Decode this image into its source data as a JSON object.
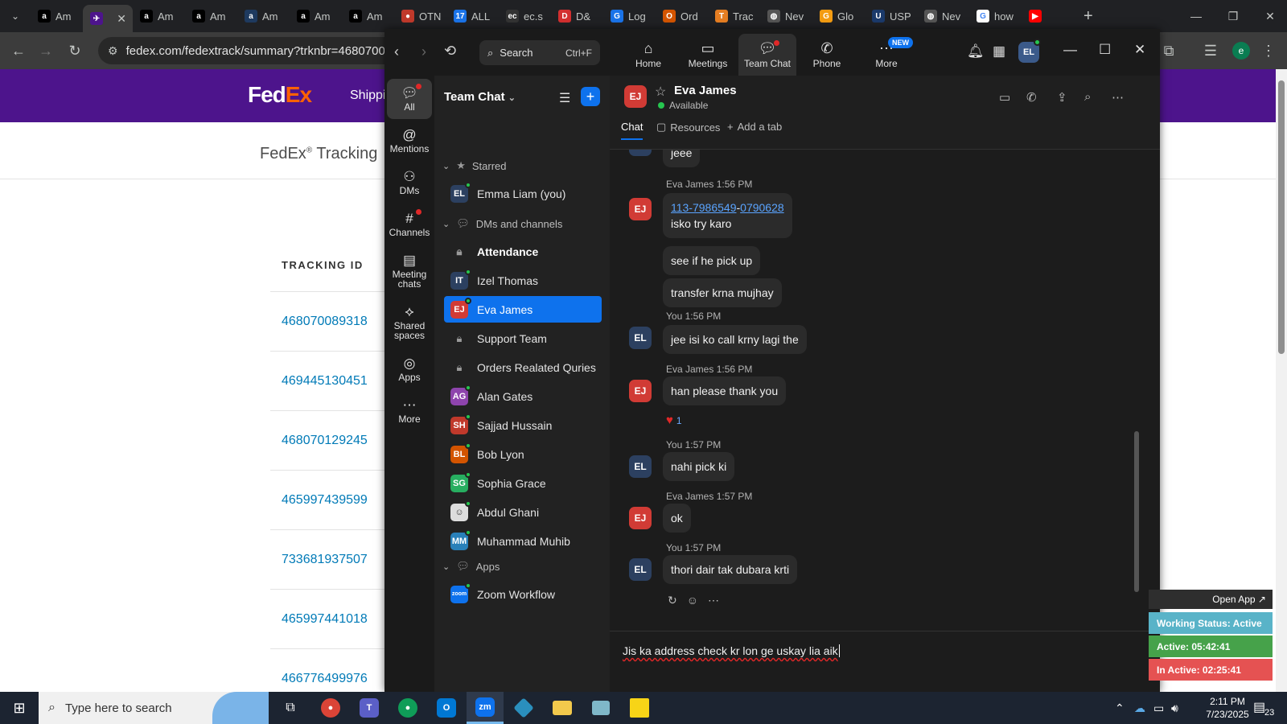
{
  "browser": {
    "tabs": [
      {
        "label": "Am",
        "icon": "amazon-icon",
        "color": "#000000",
        "glyph": "a"
      },
      {
        "label": "",
        "icon": "fedex-icon",
        "color": "#4d148c",
        "glyph": "✈"
      },
      {
        "label": "Am",
        "icon": "amazon-icon",
        "color": "#000000",
        "glyph": "a"
      },
      {
        "label": "Am",
        "icon": "amazon-icon",
        "color": "#000000",
        "glyph": "a"
      },
      {
        "label": "Am",
        "icon": "amazon-icon",
        "color": "#1e3a5f",
        "glyph": "a"
      },
      {
        "label": "Am",
        "icon": "amazon-icon",
        "color": "#000000",
        "glyph": "a"
      },
      {
        "label": "Am",
        "icon": "amazon-icon",
        "color": "#000000",
        "glyph": "a"
      },
      {
        "label": "OTN",
        "icon": "otn-icon",
        "color": "#c0392b",
        "glyph": "●"
      },
      {
        "label": "ALL",
        "icon": "all-icon",
        "color": "#1a73e8",
        "glyph": "17"
      },
      {
        "label": "ec.s",
        "icon": "ec-icon",
        "color": "#333333",
        "glyph": "ec"
      },
      {
        "label": "D&",
        "icon": "dnb-icon",
        "color": "#d32f2f",
        "glyph": "D"
      },
      {
        "label": "Log",
        "icon": "log-icon",
        "color": "#1a73e8",
        "glyph": "G"
      },
      {
        "label": "Ord",
        "icon": "orders-icon",
        "color": "#d35400",
        "glyph": "O"
      },
      {
        "label": "Trac",
        "icon": "track-icon",
        "color": "#e67e22",
        "glyph": "T"
      },
      {
        "label": "Nev",
        "icon": "globe-icon",
        "color": "#555555",
        "glyph": "◍"
      },
      {
        "label": "Glo",
        "icon": "glo-icon",
        "color": "#f39c12",
        "glyph": "G"
      },
      {
        "label": "USP",
        "icon": "usps-icon",
        "color": "#1b3a6b",
        "glyph": "U"
      },
      {
        "label": "Nev",
        "icon": "globe-icon",
        "color": "#555555",
        "glyph": "◍"
      },
      {
        "label": "how",
        "icon": "google-icon",
        "color": "#ffffff",
        "glyph": "G"
      },
      {
        "label": "",
        "icon": "youtube-icon",
        "color": "#ff0000",
        "glyph": "▶"
      }
    ],
    "url": "fedex.com/fedextrack/summary?trknbr=468070089318"
  },
  "fedex": {
    "logo_fed": "Fed",
    "logo_ex": "Ex",
    "nav_label": "Shippi",
    "page_title": "FedEx",
    "page_title_mark": "®",
    "page_title_rest": " Tracking",
    "column_header": "TRACKING ID",
    "tracking_ids": [
      "468070089318",
      "469445130451",
      "468070129245",
      "465997439599",
      "733681937507",
      "465997441018",
      "466776499976"
    ]
  },
  "zoom": {
    "search_label": "Search",
    "search_shortcut": "Ctrl+F",
    "top_tabs": [
      {
        "label": "Home",
        "icon": "home-icon"
      },
      {
        "label": "Meetings",
        "icon": "video-icon"
      },
      {
        "label": "Team Chat",
        "icon": "chat-icon"
      },
      {
        "label": "Phone",
        "icon": "phone-icon"
      },
      {
        "label": "More",
        "icon": "more-icon"
      }
    ],
    "new_badge": "NEW",
    "user_initials": "EL",
    "rail": [
      {
        "label": "All",
        "icon": "chat-bubble-icon"
      },
      {
        "label": "Mentions",
        "icon": "at-icon"
      },
      {
        "label": "DMs",
        "icon": "people-icon"
      },
      {
        "label": "Channels",
        "icon": "hash-icon"
      },
      {
        "label": "Meeting chats",
        "icon": "calendar-icon"
      },
      {
        "label": "Shared spaces",
        "icon": "share-icon"
      },
      {
        "label": "Apps",
        "icon": "apps-icon"
      },
      {
        "label": "More",
        "icon": "ellipsis-icon"
      }
    ],
    "list": {
      "title": "Team Chat",
      "starred_label": "Starred",
      "dms_label": "DMs and channels",
      "apps_label": "Apps",
      "starred": [
        {
          "name": "Emma Liam (you)",
          "initials": "EL",
          "color": "#2c4060"
        }
      ],
      "dms": [
        {
          "name": "Attendance",
          "type": "channel",
          "bold": true
        },
        {
          "name": "Izel Thomas",
          "initials": "IT",
          "color": "#2c4060"
        },
        {
          "name": "Eva James",
          "initials": "EJ",
          "color": "#d13b35",
          "selected": true
        },
        {
          "name": "Support Team",
          "type": "channel"
        },
        {
          "name": "Orders Realated Quries",
          "type": "channel"
        },
        {
          "name": "Alan Gates",
          "initials": "AG",
          "color": "#8e44ad"
        },
        {
          "name": "Sajjad Hussain",
          "initials": "SH",
          "color": "#c0392b"
        },
        {
          "name": "Bob Lyon",
          "initials": "BL",
          "color": "#d35400"
        },
        {
          "name": "Sophia Grace",
          "initials": "SG",
          "color": "#27ae60"
        },
        {
          "name": "Abdul Ghani",
          "initials": "",
          "color": "#dddddd",
          "photo": true
        },
        {
          "name": "Muhammad Muhib",
          "initials": "MM",
          "color": "#2980b9"
        }
      ],
      "apps": [
        {
          "name": "Zoom Workflow",
          "initials": "zoom",
          "color": "#0e72ed"
        }
      ]
    },
    "chat": {
      "contact_initials": "EJ",
      "contact_name": "Eva James",
      "contact_status": "Available",
      "tabs": [
        "Chat",
        "Resources",
        "Add a tab"
      ],
      "partial_top": "jeee",
      "messages": [
        {
          "sender": "Eva James",
          "time": "1:56 PM",
          "initials": "EJ",
          "lines": [
            "113-7986549-0790628",
            "isko try karo"
          ],
          "link_a": "113-7986549",
          "link_b": "0790628"
        },
        {
          "text": "see if he pick up"
        },
        {
          "text": "transfer krna mujhay"
        },
        {
          "sender": "You",
          "time": "1:56 PM",
          "initials": "EL",
          "text": "jee isi ko call krny lagi the"
        },
        {
          "sender": "Eva James",
          "time": "1:56 PM",
          "initials": "EJ",
          "text": "han please thank you",
          "reaction_count": "1"
        },
        {
          "sender": "You",
          "time": "1:57 PM",
          "initials": "EL",
          "text": "nahi pick ki"
        },
        {
          "sender": "Eva James",
          "time": "1:57 PM",
          "initials": "EJ",
          "text": "ok"
        },
        {
          "sender": "You",
          "time": "1:57 PM",
          "initials": "EL",
          "text": "thori dair tak dubara krti"
        }
      ],
      "draft": "Jis ka address check kr lon ge uskay lia aik"
    }
  },
  "overlay": {
    "open_app": "Open App ↗",
    "working_status": "Working Status: Active",
    "active_time": "Active: 05:42:41",
    "inactive_time": "In Active: 02:25:41"
  },
  "taskbar": {
    "search_placeholder": "Type here to search",
    "time": "2:11 PM",
    "date": "7/23/2025",
    "notification_count": "23"
  }
}
